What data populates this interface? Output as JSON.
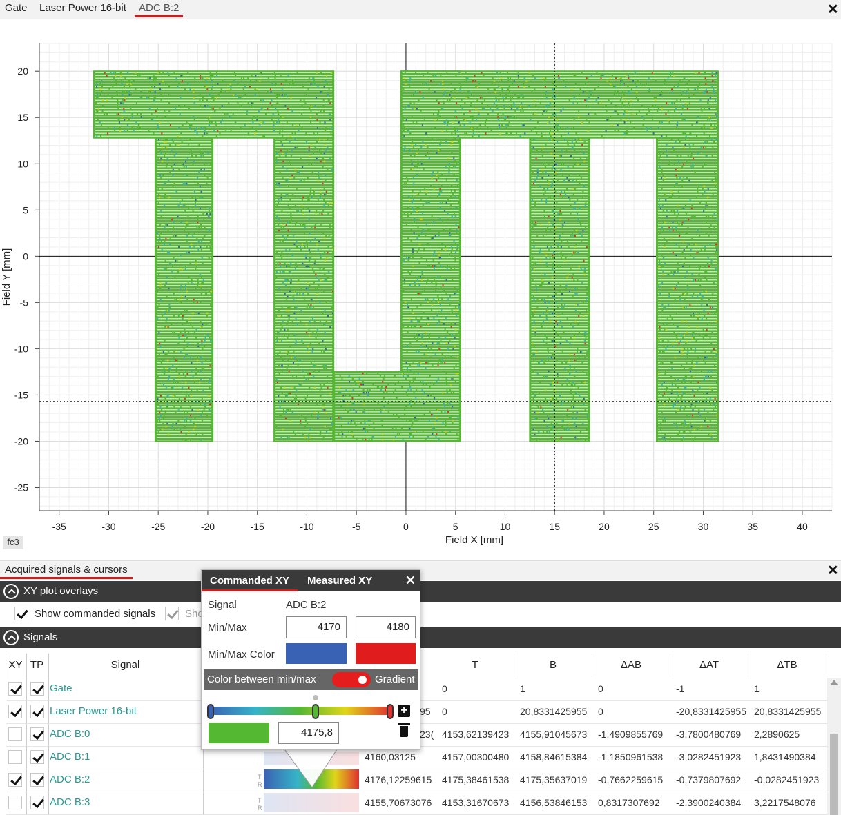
{
  "top_tabs": [
    "Gate",
    "Laser Power 16-bit",
    "ADC B:2"
  ],
  "chart_data": {
    "type": "scatter",
    "title": "",
    "xlabel": "Field X [mm]",
    "ylabel": "Field Y [mm]",
    "xlim": [
      -37,
      43
    ],
    "ylim": [
      -27.5,
      23
    ],
    "xticks": [
      -35,
      -30,
      -25,
      -20,
      -15,
      -10,
      -5,
      0,
      5,
      10,
      15,
      20,
      25,
      30,
      35,
      40
    ],
    "yticks": [
      20,
      15,
      10,
      5,
      0,
      -5,
      -10,
      -15,
      -20,
      -25
    ],
    "grid": true,
    "cursor_x": 15,
    "cursor_y": -15.7,
    "color_scale": {
      "min": 4170,
      "max": 4180,
      "colors": [
        "#3a62b4",
        "#36b3c8",
        "#55b832",
        "#e0d51a",
        "#e03030"
      ]
    },
    "regions": [
      {
        "name": "T top bar",
        "x": [
          -31.5,
          -7.3
        ],
        "y": [
          12.8,
          20
        ]
      },
      {
        "name": "T stem",
        "x": [
          -25.3,
          -19.5
        ],
        "y": [
          -20,
          12.8
        ]
      },
      {
        "name": "U left",
        "x": [
          -13.3,
          -7.3
        ],
        "y": [
          -20,
          12.8
        ]
      },
      {
        "name": "U bottom",
        "x": [
          -7.3,
          5.5
        ],
        "y": [
          -20,
          -12.5
        ]
      },
      {
        "name": "U right",
        "x": [
          -0.5,
          5.5
        ],
        "y": [
          -12.5,
          20
        ]
      },
      {
        "name": "M top bar",
        "x": [
          -0.5,
          31.5
        ],
        "y": [
          12.8,
          20
        ]
      },
      {
        "name": "M left leg",
        "x": [
          12.5,
          18.5
        ],
        "y": [
          -20,
          12.8
        ]
      },
      {
        "name": "M right leg",
        "x": [
          25.3,
          31.5
        ],
        "y": [
          -20,
          12.8
        ]
      }
    ]
  },
  "chart_tag": "fc3",
  "bottom_tab": "Acquired signals & cursors",
  "overlays": {
    "header": "XY plot overlays",
    "show_commanded": "Show commanded signals",
    "show_measured_partial": "Sho"
  },
  "signals": {
    "header": "Signals",
    "columns": [
      "XY",
      "TP",
      "Signal",
      "T",
      "B",
      "ΔAB",
      "ΔAT",
      "ΔTB"
    ],
    "rows": [
      {
        "xy": true,
        "tp": true,
        "name": "Gate",
        "a": "",
        "t": "0",
        "b": "1",
        "dab": "0",
        "dat": "-1",
        "dtb": "1"
      },
      {
        "xy": true,
        "tp": true,
        "name": "Laser Power 16-bit",
        "a": "95",
        "t": "0",
        "b": "20,8331425955",
        "dab": "0",
        "dat": "-20,8331425955",
        "dtb": "20,8331425955"
      },
      {
        "xy": false,
        "tp": true,
        "name": "ADC B:0",
        "a": "23(",
        "t": "4153,62139423",
        "b": "4155,91045673",
        "dab": "-1,4909855769",
        "dat": "-3,7800480769",
        "dtb": "2,2890625"
      },
      {
        "xy": false,
        "tp": true,
        "name": "ADC B:1",
        "a": "4160,03125",
        "t": "4157,00300480",
        "b": "4158,84615384",
        "dab": "-1,1850961538",
        "dat": "-3,0282451923",
        "dtb": "1,8431490384"
      },
      {
        "xy": true,
        "tp": true,
        "name": "ADC B:2",
        "a": "4176,12259615",
        "t": "4175,38461538",
        "b": "4175,35637019",
        "dab": "-0,7662259615",
        "dat": "-0,7379807692",
        "dtb": "-0,0282451923"
      },
      {
        "xy": false,
        "tp": true,
        "name": "ADC B:3",
        "a": "4155,70673076",
        "t": "4153,31670673",
        "b": "4156,53846153",
        "dab": "0,8317307692",
        "dat": "-2,3900240384",
        "dtb": "3,2217548076"
      }
    ]
  },
  "popup": {
    "tabs": [
      "Commanded XY",
      "Measured XY"
    ],
    "signal_label": "Signal",
    "signal_value": "ADC B:2",
    "minmax_label": "Min/Max",
    "min_value": "4170",
    "max_value": "4180",
    "color_label": "Min/Max Color",
    "min_color": "#3a62b4",
    "max_color": "#e01c1c",
    "between_label": "Color between min/max",
    "gradient_label": "Gradient",
    "stop_value": "4175,8",
    "stop_color": "#55b832"
  }
}
